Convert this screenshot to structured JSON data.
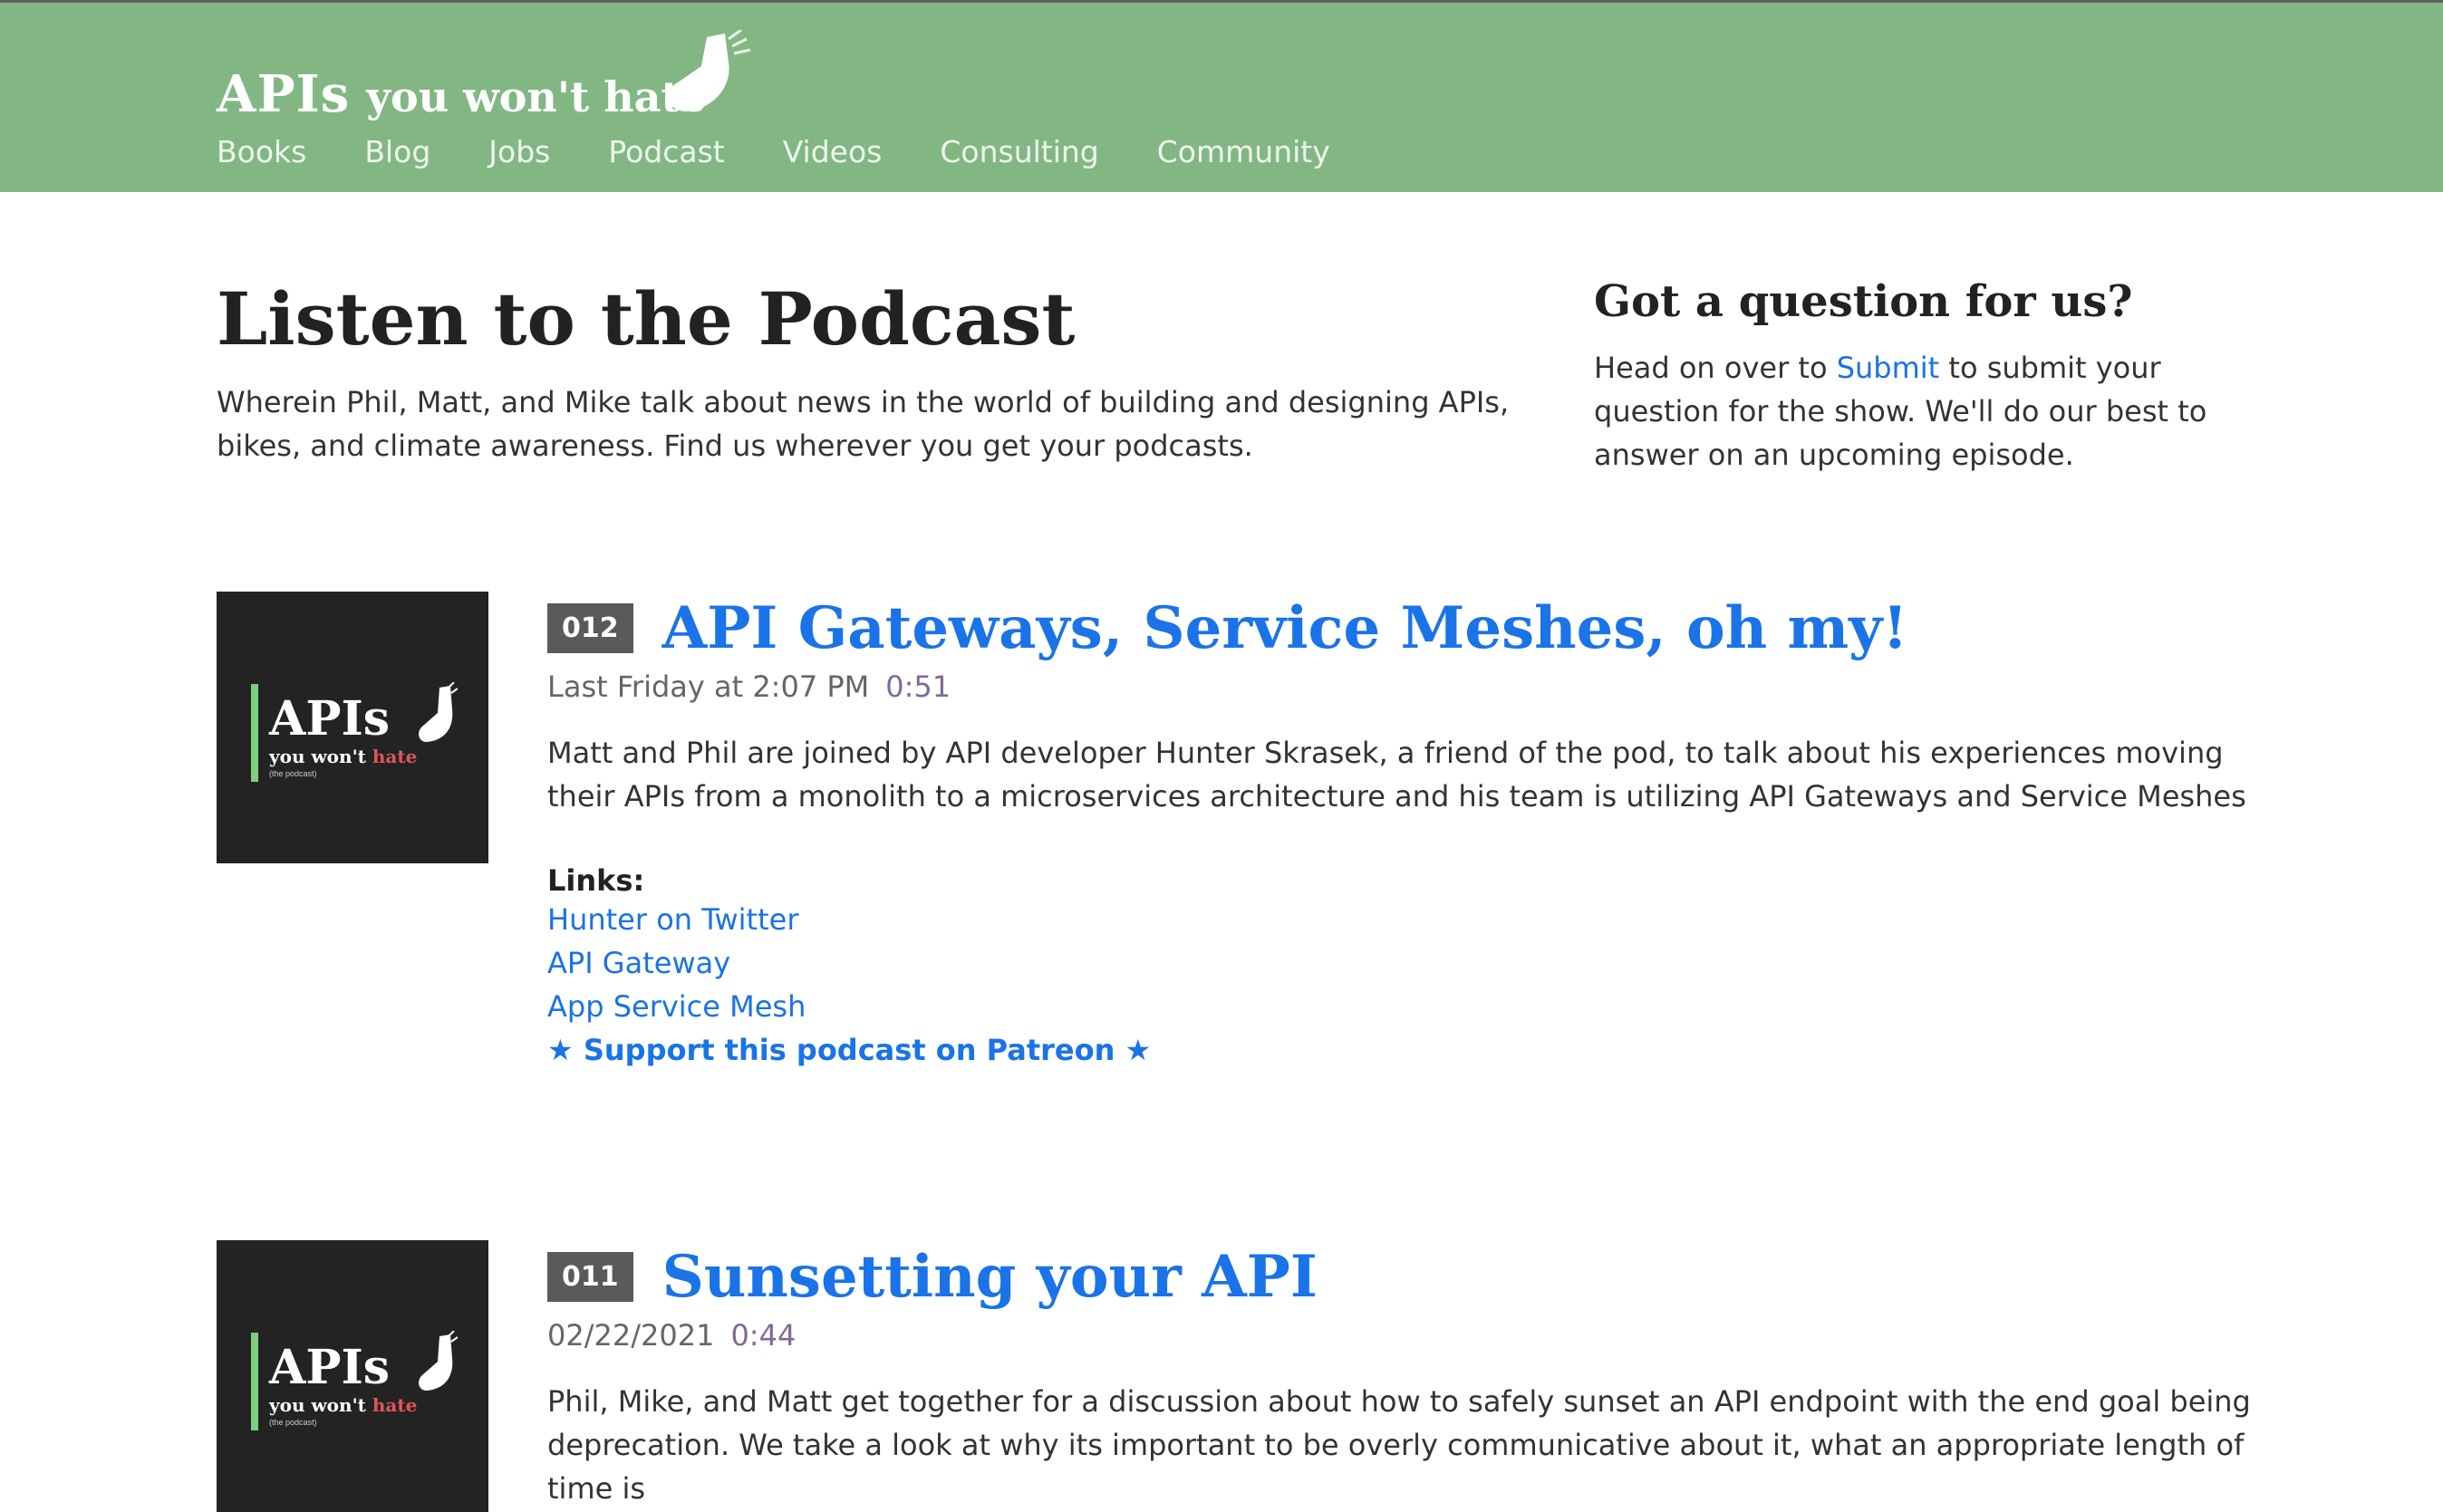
{
  "site": {
    "logo_big": "APIs",
    "logo_small": "you won't hate",
    "nav": [
      "Books",
      "Blog",
      "Jobs",
      "Podcast",
      "Videos",
      "Consulting",
      "Community"
    ]
  },
  "hero": {
    "title": "Listen to the Podcast",
    "description": "Wherein Phil, Matt, and Mike talk about news in the world of building and designing APIs, bikes, and climate awareness. Find us wherever you get your podcasts."
  },
  "sidebar": {
    "title": "Got a question for us?",
    "text_before": "Head on over to ",
    "link": "Submit",
    "text_after": " to submit your question for the show. We'll do our best to answer on an upcoming episode."
  },
  "cover": {
    "apis": "APIs",
    "you_wont": "you won't ",
    "hate": "hate",
    "podcast": "(the podcast)"
  },
  "episodes": [
    {
      "number": "012",
      "title": "API Gateways, Service Meshes, oh my!",
      "date": "Last Friday at 2:07 PM",
      "duration": "0:51",
      "description": "Matt and Phil are joined by API developer Hunter Skrasek, a friend of the pod, to talk about his experiences moving their APIs from a monolith to a microservices architecture and his team is utilizing API Gateways and Service Meshes",
      "links_label": "Links:",
      "links": [
        "Hunter on Twitter",
        "API Gateway",
        "App Service Mesh"
      ],
      "patreon": "★ Support this podcast on Patreon ★"
    },
    {
      "number": "011",
      "title": "Sunsetting your API",
      "date": "02/22/2021",
      "duration": "0:44",
      "description": "Phil, Mike, and Matt get together for a discussion about how to safely sunset an API endpoint with the end goal being deprecation. We take a look at why its important to be overly communicative about it, what an appropriate length of time is"
    }
  ],
  "colors": {
    "header_bg": "#82b784",
    "link": "#1a73e8",
    "cover_bg": "#232323",
    "badge_bg": "#5a5a5a"
  }
}
